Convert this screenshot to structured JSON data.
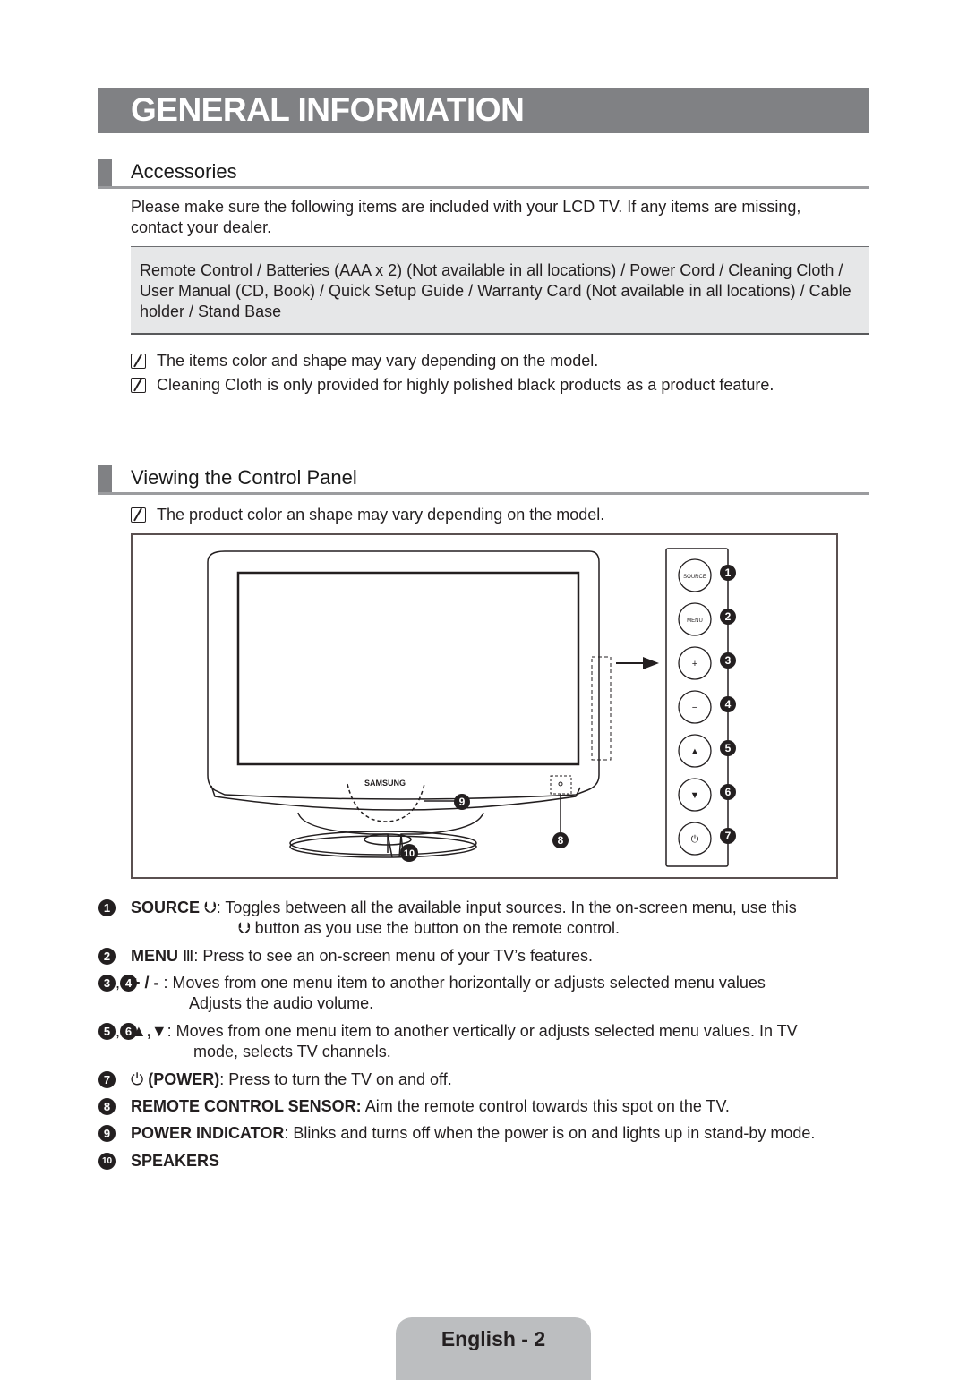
{
  "page_title": "GENERAL INFORMATION",
  "accessories": {
    "heading": "Accessories",
    "intro": "Please make sure the following items are included with your LCD TV. If any items are missing, contact your dealer.",
    "items_box": "Remote Control / Batteries (AAA x 2) (Not available in all locations) / Power Cord / Cleaning Cloth / User Manual (CD, Book) / Quick Setup Guide / Warranty Card (Not available in all locations) / Cable holder / Stand Base",
    "notes": [
      "The items color and shape may vary depending on the model.",
      "Cleaning Cloth is only provided for highly polished black products as a product feature."
    ]
  },
  "control_panel": {
    "heading": "Viewing the Control Panel",
    "note": "The product color an shape may vary depending on the model.",
    "diagram": {
      "brand": "SAMSUNG",
      "buttons": [
        {
          "num": "1",
          "label": "SOURCE"
        },
        {
          "num": "2",
          "label": "MENU"
        },
        {
          "num": "3",
          "label": "+"
        },
        {
          "num": "4",
          "label": "−"
        },
        {
          "num": "5",
          "label": "▲"
        },
        {
          "num": "6",
          "label": "▼"
        },
        {
          "num": "7",
          "label": "⏻"
        }
      ],
      "callouts": {
        "sensor": "8",
        "indicator": "9",
        "speakers": "10"
      }
    },
    "descriptions": [
      {
        "nums": [
          "1"
        ],
        "term": "SOURCE",
        "icon": "⮋",
        "text": ": Toggles between all the available input sources. In the on-screen menu, use this",
        "cont_icon": "⮋",
        "cont": " button as you use the button on the remote control."
      },
      {
        "nums": [
          "2"
        ],
        "term": "MENU",
        "icon": "Ⅲ",
        "text": ": Press to see an on-screen menu of your TV’s features."
      },
      {
        "nums": [
          "3",
          "4"
        ],
        "term": "+ / - ",
        "text": ": Moves from one menu item to another horizontally or adjusts selected menu values",
        "cont": "Adjusts the audio volume."
      },
      {
        "nums": [
          "5",
          "6"
        ],
        "term": "▲,▼",
        "text": ": Moves from one menu item to another vertically or adjusts selected menu values. In TV",
        "cont": "mode, selects TV channels."
      },
      {
        "nums": [
          "7"
        ],
        "term": "(POWER)",
        "icon": "⏻",
        "text": ": Press to turn the TV on and off."
      },
      {
        "nums": [
          "8"
        ],
        "term": "REMOTE CONTROL SENSOR:",
        "text": " Aim the remote control towards this spot on the TV."
      },
      {
        "nums": [
          "9"
        ],
        "term": "POWER INDICATOR",
        "text": ": Blinks and turns off when the power is on and lights up in stand-by mode."
      },
      {
        "nums": [
          "10"
        ],
        "term": "SPEAKERS",
        "text": ""
      }
    ]
  },
  "footer": {
    "label": "English - 2"
  }
}
